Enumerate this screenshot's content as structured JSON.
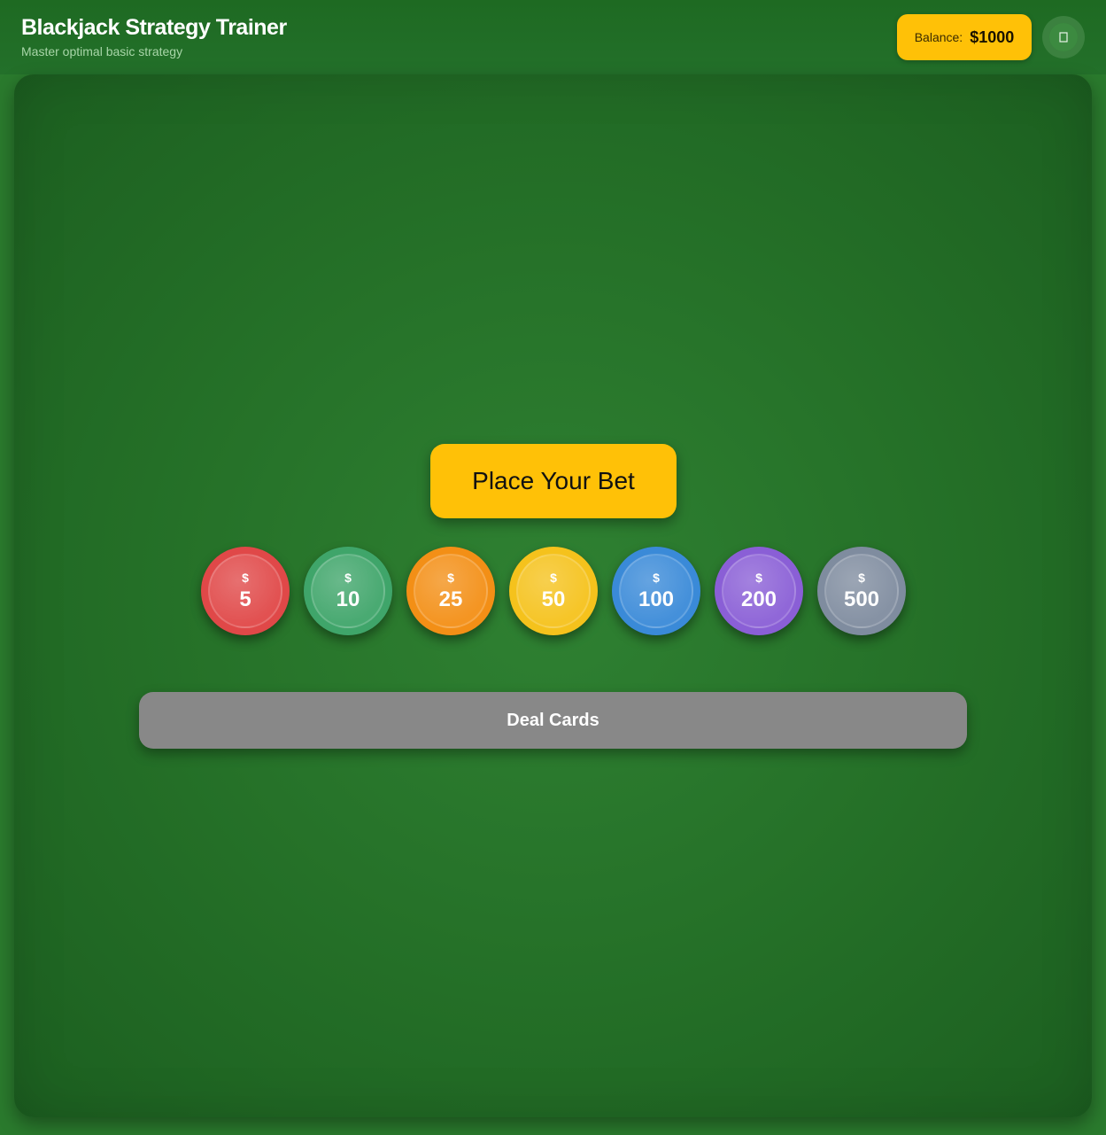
{
  "header": {
    "title": "Blackjack Strategy Trainer",
    "subtitle": "Master optimal basic strategy",
    "balance_label": "Balance:",
    "balance_value": "$1000",
    "settings_icon": "settings-icon"
  },
  "table": {
    "bet_prompt": "Place Your Bet",
    "deal_label": "Deal Cards",
    "chips": [
      {
        "symbol": "$",
        "value": "5",
        "color": "#e04848"
      },
      {
        "symbol": "$",
        "value": "10",
        "color": "#3fa56a"
      },
      {
        "symbol": "$",
        "value": "25",
        "color": "#f38f16"
      },
      {
        "symbol": "$",
        "value": "50",
        "color": "#f5c21c"
      },
      {
        "symbol": "$",
        "value": "100",
        "color": "#3a8ad8"
      },
      {
        "symbol": "$",
        "value": "200",
        "color": "#8a5fd6"
      },
      {
        "symbol": "$",
        "value": "500",
        "color": "#7f8c9f"
      }
    ]
  },
  "colors": {
    "accent": "#ffc107",
    "felt": "#2a7a2d",
    "deal_disabled": "#888888"
  }
}
